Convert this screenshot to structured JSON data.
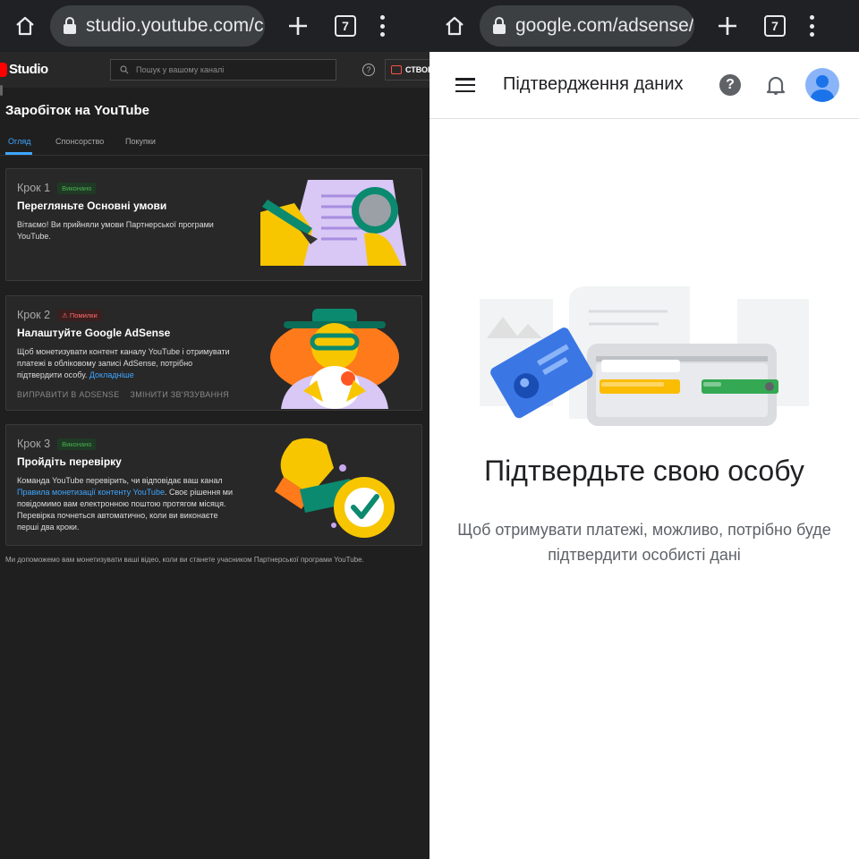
{
  "left_chrome": {
    "url": "studio.youtube.com/c",
    "tab_count": "7"
  },
  "right_chrome": {
    "url": "google.com/adsense/",
    "tab_count": "7"
  },
  "studio": {
    "logo_text": "Studio",
    "search_placeholder": "Пошук у вашому каналі",
    "create_label": "СТВОР",
    "help_glyph": "?",
    "page_title": "Заробіток на YouTube",
    "tabs": [
      {
        "label": "Огляд"
      },
      {
        "label": "Спонсорство"
      },
      {
        "label": "Покупки"
      }
    ],
    "steps": [
      {
        "step": "Крок 1",
        "badge": "Виконано",
        "title": "Перегляньте Основні умови",
        "desc": "Вітаємо! Ви прийняли умови Партнерської програми YouTube."
      },
      {
        "step": "Крок 2",
        "badge": "⚠ Помилки",
        "title": "Налаштуйте Google AdSense",
        "desc": "Щоб монетизувати контент каналу YouTube і отримувати платежі в обліковому записі AdSense, потрібно підтвердити особу.",
        "link": "Докладніше",
        "action1": "ВИПРАВИТИ В ADSENSE",
        "action2": "ЗМІНИТИ ЗВ'ЯЗУВАННЯ"
      },
      {
        "step": "Крок 3",
        "badge": "Виконано",
        "title": "Пройдіть перевірку",
        "desc_a": "Команда YouTube перевірить, чи відповідає ваш канал",
        "link": "Правила монетизації контенту YouTube",
        "desc_b": ". Своє рішення ми повідомимо вам електронною поштою протягом місяця. Перевірка почнеться автоматично, коли ви виконаєте перші два кроки."
      }
    ],
    "footer": "Ми допоможемо вам монетизувати ваші відео, коли ви станете учасником Партнерської програми YouTube."
  },
  "adsense": {
    "title": "Підтвердження даних",
    "help_glyph": "?",
    "heading": "Підтвердьте свою особу",
    "body": "Щоб отримувати платежі, можливо, потрібно буде підтвердити особисті дані"
  },
  "colors": {
    "studio_bg": "#1f1f1f",
    "studio_card": "#282828",
    "link_blue": "#3ea6ff",
    "yt_red": "#ff0000",
    "adsense_avatar": "#8ab4f8"
  }
}
